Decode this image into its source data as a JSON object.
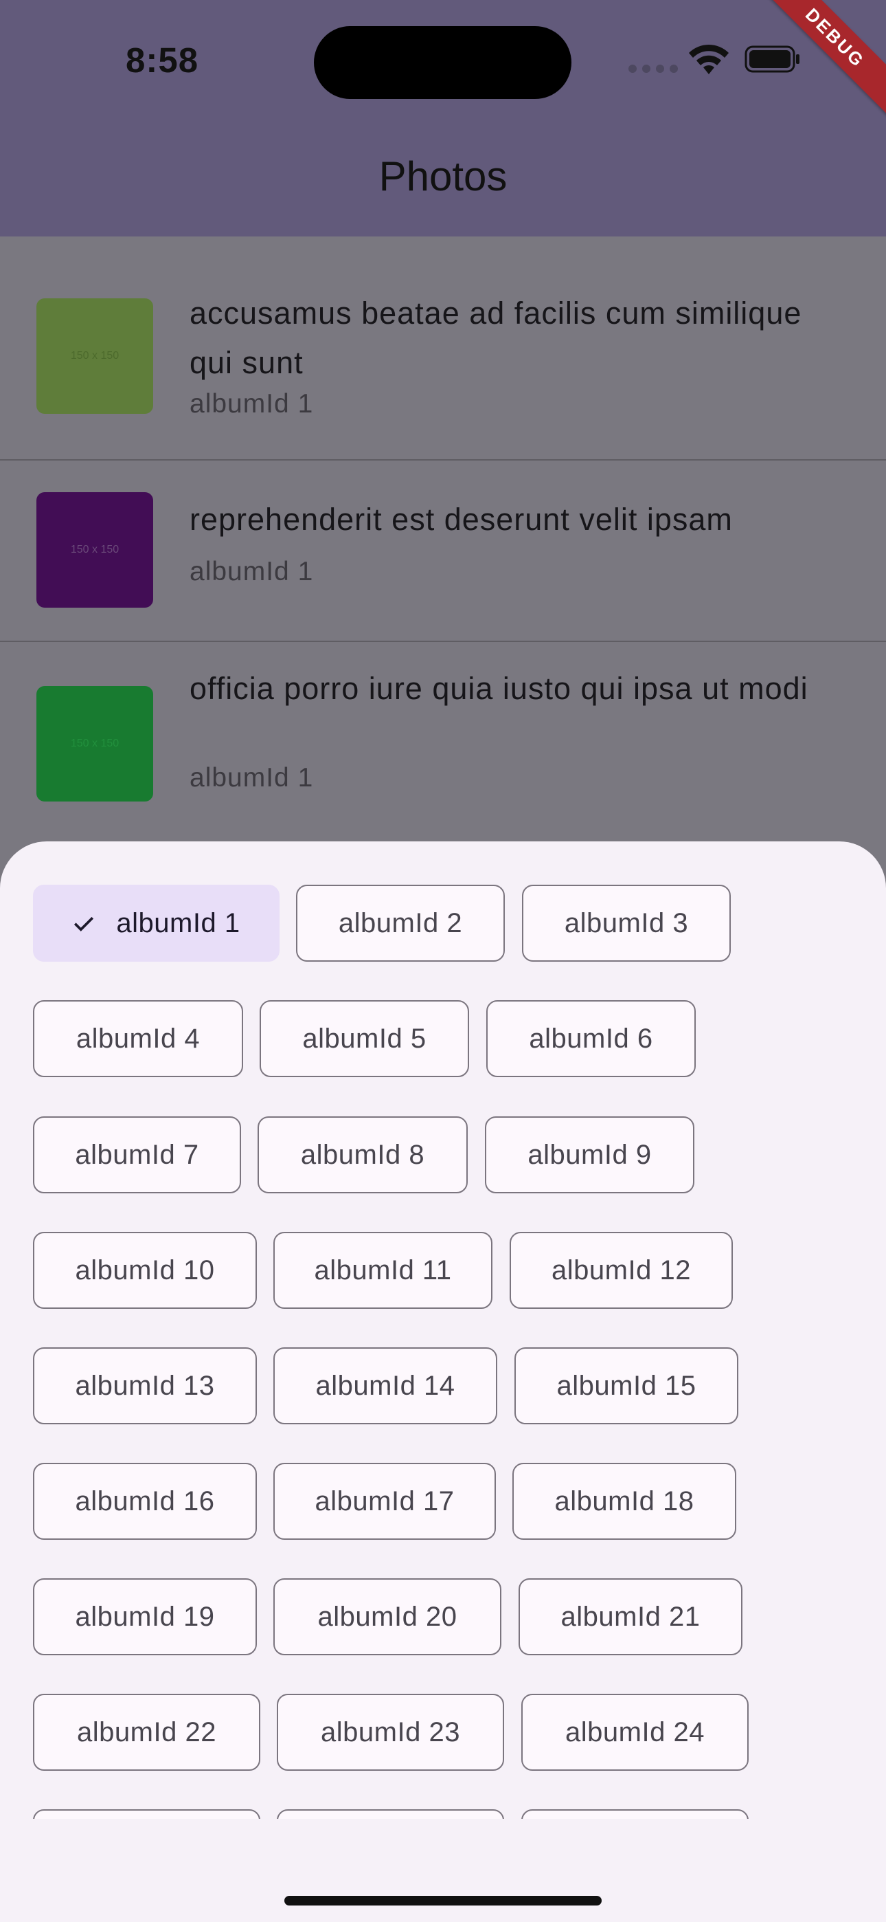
{
  "status_bar": {
    "time": "8:58",
    "icons": [
      "cellular-signal-icon",
      "wifi-icon",
      "battery-icon"
    ]
  },
  "debug_banner": "DEBUG",
  "app_bar": {
    "title": "Photos"
  },
  "photos": [
    {
      "title": "accusamus beatae ad facilis cum similique qui sunt",
      "album": "albumId 1",
      "thumb_label": "150 x 150",
      "thumb_color": "#5f7d3a"
    },
    {
      "title": "reprehenderit est deserunt velit ipsam",
      "album": "albumId 1",
      "thumb_label": "150 x 150",
      "thumb_color": "#420d55"
    },
    {
      "title": "officia porro iure quia iusto qui ipsa ut modi",
      "album": "albumId 1",
      "thumb_label": "150 x 150",
      "thumb_color": "#187b30"
    }
  ],
  "filter_sheet": {
    "selected_index": 0,
    "chips": [
      "albumId 1",
      "albumId 2",
      "albumId 3",
      "albumId 4",
      "albumId 5",
      "albumId 6",
      "albumId 7",
      "albumId 8",
      "albumId 9",
      "albumId 10",
      "albumId 11",
      "albumId 12",
      "albumId 13",
      "albumId 14",
      "albumId 15",
      "albumId 16",
      "albumId 17",
      "albumId 18",
      "albumId 19",
      "albumId 20",
      "albumId 21",
      "albumId 22",
      "albumId 23",
      "albumId 24"
    ]
  },
  "colors": {
    "app_bar": "#625a7b",
    "sheet_background": "#f6f1f8",
    "selected_chip": "#e8def8",
    "chip_border": "#7b757f"
  }
}
